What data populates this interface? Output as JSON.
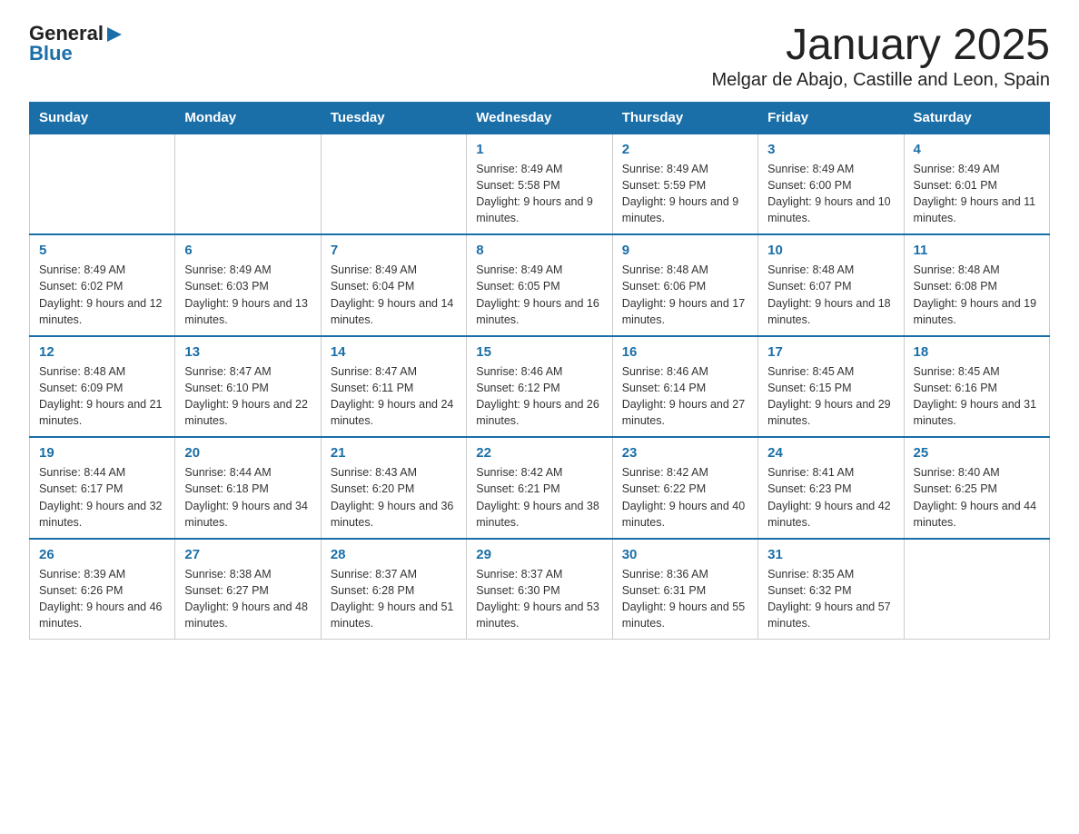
{
  "header": {
    "logo_general": "General",
    "logo_blue": "Blue",
    "month_title": "January 2025",
    "location": "Melgar de Abajo, Castille and Leon, Spain"
  },
  "days_of_week": [
    "Sunday",
    "Monday",
    "Tuesday",
    "Wednesday",
    "Thursday",
    "Friday",
    "Saturday"
  ],
  "weeks": [
    [
      {
        "day": "",
        "info": ""
      },
      {
        "day": "",
        "info": ""
      },
      {
        "day": "",
        "info": ""
      },
      {
        "day": "1",
        "info": "Sunrise: 8:49 AM\nSunset: 5:58 PM\nDaylight: 9 hours and 9 minutes."
      },
      {
        "day": "2",
        "info": "Sunrise: 8:49 AM\nSunset: 5:59 PM\nDaylight: 9 hours and 9 minutes."
      },
      {
        "day": "3",
        "info": "Sunrise: 8:49 AM\nSunset: 6:00 PM\nDaylight: 9 hours and 10 minutes."
      },
      {
        "day": "4",
        "info": "Sunrise: 8:49 AM\nSunset: 6:01 PM\nDaylight: 9 hours and 11 minutes."
      }
    ],
    [
      {
        "day": "5",
        "info": "Sunrise: 8:49 AM\nSunset: 6:02 PM\nDaylight: 9 hours and 12 minutes."
      },
      {
        "day": "6",
        "info": "Sunrise: 8:49 AM\nSunset: 6:03 PM\nDaylight: 9 hours and 13 minutes."
      },
      {
        "day": "7",
        "info": "Sunrise: 8:49 AM\nSunset: 6:04 PM\nDaylight: 9 hours and 14 minutes."
      },
      {
        "day": "8",
        "info": "Sunrise: 8:49 AM\nSunset: 6:05 PM\nDaylight: 9 hours and 16 minutes."
      },
      {
        "day": "9",
        "info": "Sunrise: 8:48 AM\nSunset: 6:06 PM\nDaylight: 9 hours and 17 minutes."
      },
      {
        "day": "10",
        "info": "Sunrise: 8:48 AM\nSunset: 6:07 PM\nDaylight: 9 hours and 18 minutes."
      },
      {
        "day": "11",
        "info": "Sunrise: 8:48 AM\nSunset: 6:08 PM\nDaylight: 9 hours and 19 minutes."
      }
    ],
    [
      {
        "day": "12",
        "info": "Sunrise: 8:48 AM\nSunset: 6:09 PM\nDaylight: 9 hours and 21 minutes."
      },
      {
        "day": "13",
        "info": "Sunrise: 8:47 AM\nSunset: 6:10 PM\nDaylight: 9 hours and 22 minutes."
      },
      {
        "day": "14",
        "info": "Sunrise: 8:47 AM\nSunset: 6:11 PM\nDaylight: 9 hours and 24 minutes."
      },
      {
        "day": "15",
        "info": "Sunrise: 8:46 AM\nSunset: 6:12 PM\nDaylight: 9 hours and 26 minutes."
      },
      {
        "day": "16",
        "info": "Sunrise: 8:46 AM\nSunset: 6:14 PM\nDaylight: 9 hours and 27 minutes."
      },
      {
        "day": "17",
        "info": "Sunrise: 8:45 AM\nSunset: 6:15 PM\nDaylight: 9 hours and 29 minutes."
      },
      {
        "day": "18",
        "info": "Sunrise: 8:45 AM\nSunset: 6:16 PM\nDaylight: 9 hours and 31 minutes."
      }
    ],
    [
      {
        "day": "19",
        "info": "Sunrise: 8:44 AM\nSunset: 6:17 PM\nDaylight: 9 hours and 32 minutes."
      },
      {
        "day": "20",
        "info": "Sunrise: 8:44 AM\nSunset: 6:18 PM\nDaylight: 9 hours and 34 minutes."
      },
      {
        "day": "21",
        "info": "Sunrise: 8:43 AM\nSunset: 6:20 PM\nDaylight: 9 hours and 36 minutes."
      },
      {
        "day": "22",
        "info": "Sunrise: 8:42 AM\nSunset: 6:21 PM\nDaylight: 9 hours and 38 minutes."
      },
      {
        "day": "23",
        "info": "Sunrise: 8:42 AM\nSunset: 6:22 PM\nDaylight: 9 hours and 40 minutes."
      },
      {
        "day": "24",
        "info": "Sunrise: 8:41 AM\nSunset: 6:23 PM\nDaylight: 9 hours and 42 minutes."
      },
      {
        "day": "25",
        "info": "Sunrise: 8:40 AM\nSunset: 6:25 PM\nDaylight: 9 hours and 44 minutes."
      }
    ],
    [
      {
        "day": "26",
        "info": "Sunrise: 8:39 AM\nSunset: 6:26 PM\nDaylight: 9 hours and 46 minutes."
      },
      {
        "day": "27",
        "info": "Sunrise: 8:38 AM\nSunset: 6:27 PM\nDaylight: 9 hours and 48 minutes."
      },
      {
        "day": "28",
        "info": "Sunrise: 8:37 AM\nSunset: 6:28 PM\nDaylight: 9 hours and 51 minutes."
      },
      {
        "day": "29",
        "info": "Sunrise: 8:37 AM\nSunset: 6:30 PM\nDaylight: 9 hours and 53 minutes."
      },
      {
        "day": "30",
        "info": "Sunrise: 8:36 AM\nSunset: 6:31 PM\nDaylight: 9 hours and 55 minutes."
      },
      {
        "day": "31",
        "info": "Sunrise: 8:35 AM\nSunset: 6:32 PM\nDaylight: 9 hours and 57 minutes."
      },
      {
        "day": "",
        "info": ""
      }
    ]
  ]
}
